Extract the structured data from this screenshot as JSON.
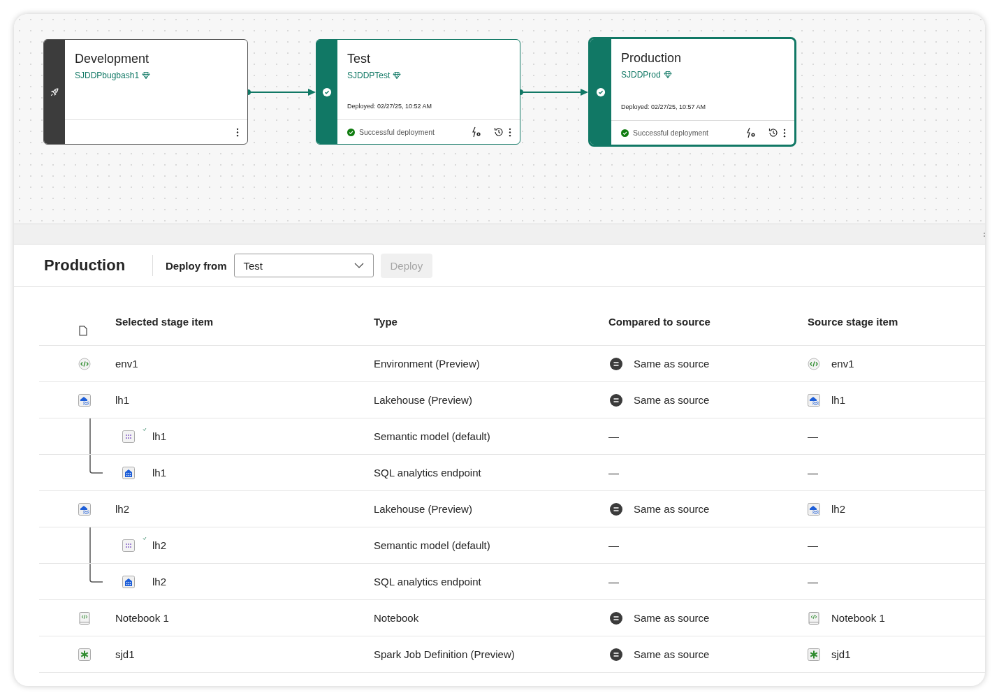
{
  "pipeline": {
    "stages": [
      {
        "name": "Development",
        "workspace": "SJDDPbugbash1",
        "kind": "source",
        "selected": false
      },
      {
        "name": "Test",
        "workspace": "SJDDPTest",
        "kind": "deployed",
        "selected": false,
        "deployed": "Deployed: 02/27/25, 10:52 AM",
        "status": "Successful deployment"
      },
      {
        "name": "Production",
        "workspace": "SJDDProd",
        "kind": "deployed",
        "selected": true,
        "deployed": "Deployed: 02/27/25, 10:57 AM",
        "status": "Successful deployment"
      }
    ]
  },
  "toolbar": {
    "title": "Production",
    "deploy_from_label": "Deploy from",
    "deploy_from_value": "Test",
    "deploy_button": {
      "label": "Deploy",
      "disabled": true
    }
  },
  "table": {
    "columns": [
      "Selected stage item",
      "Type",
      "Compared to source",
      "Source stage item"
    ],
    "rows": [
      {
        "kind": "environment",
        "name": "env1",
        "type": "Environment (Preview)",
        "compared": {
          "kind": "same",
          "label": "Same as source"
        },
        "source": "env1"
      },
      {
        "kind": "lakehouse",
        "name": "lh1",
        "type": "Lakehouse (Preview)",
        "compared": {
          "kind": "same",
          "label": "Same as source"
        },
        "source": "lh1",
        "children": [
          {
            "kind": "semantic-model",
            "name": "lh1",
            "type": "Semantic model (default)",
            "compared": {
              "kind": "none",
              "label": "—"
            },
            "source": "—"
          },
          {
            "kind": "sql-endpoint",
            "name": "lh1",
            "type": "SQL analytics endpoint",
            "compared": {
              "kind": "none",
              "label": "—"
            },
            "source": "—"
          }
        ]
      },
      {
        "kind": "lakehouse",
        "name": "lh2",
        "type": "Lakehouse (Preview)",
        "compared": {
          "kind": "same",
          "label": "Same as source"
        },
        "source": "lh2",
        "children": [
          {
            "kind": "semantic-model",
            "name": "lh2",
            "type": "Semantic model (default)",
            "compared": {
              "kind": "none",
              "label": "—"
            },
            "source": "—"
          },
          {
            "kind": "sql-endpoint",
            "name": "lh2",
            "type": "SQL analytics endpoint",
            "compared": {
              "kind": "none",
              "label": "—"
            },
            "source": "—"
          }
        ]
      },
      {
        "kind": "notebook",
        "name": "Notebook 1",
        "type": "Notebook",
        "compared": {
          "kind": "same",
          "label": "Same as source"
        },
        "source": "Notebook 1"
      },
      {
        "kind": "spark-job",
        "name": "sjd1",
        "type": "Spark Job Definition (Preview)",
        "compared": {
          "kind": "same",
          "label": "Same as source"
        },
        "source": "sjd1"
      }
    ]
  }
}
